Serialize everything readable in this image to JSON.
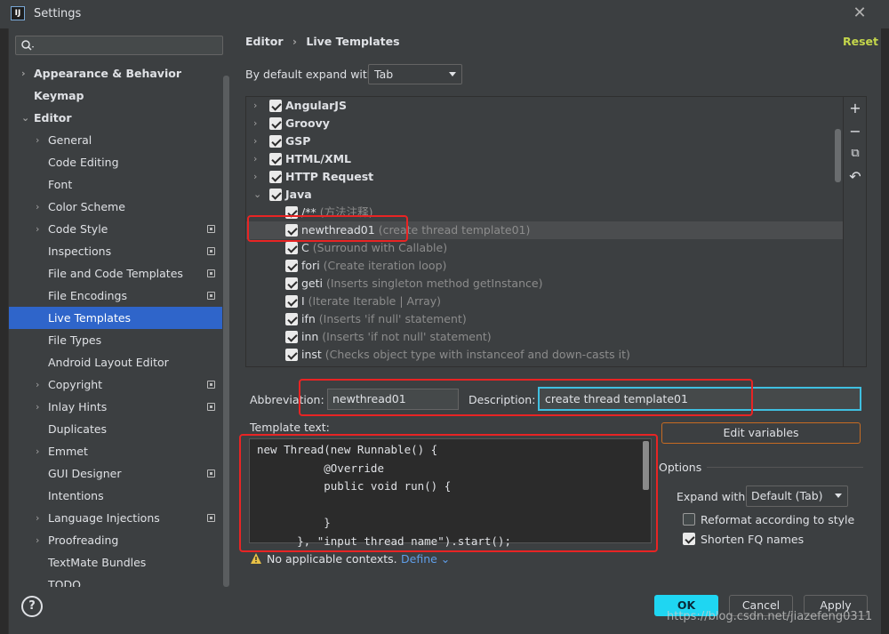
{
  "window": {
    "title": "Settings",
    "logo": "IJ",
    "close": "✕"
  },
  "search": {
    "placeholder": ""
  },
  "tree": [
    {
      "label": "Appearance & Behavior",
      "bold": true,
      "arrow": "›",
      "indent": 0
    },
    {
      "label": "Keymap",
      "bold": true,
      "arrow": "",
      "indent": 0
    },
    {
      "label": "Editor",
      "bold": true,
      "arrow": "⌄",
      "indent": 0
    },
    {
      "label": "General",
      "arrow": "›",
      "indent": 1
    },
    {
      "label": "Code Editing",
      "arrow": "",
      "indent": 1
    },
    {
      "label": "Font",
      "arrow": "",
      "indent": 1
    },
    {
      "label": "Color Scheme",
      "arrow": "›",
      "indent": 1
    },
    {
      "label": "Code Style",
      "arrow": "›",
      "indent": 1,
      "copy": true
    },
    {
      "label": "Inspections",
      "arrow": "",
      "indent": 1,
      "copy": true
    },
    {
      "label": "File and Code Templates",
      "arrow": "",
      "indent": 1,
      "copy": true
    },
    {
      "label": "File Encodings",
      "arrow": "",
      "indent": 1,
      "copy": true
    },
    {
      "label": "Live Templates",
      "arrow": "",
      "indent": 1,
      "selected": true
    },
    {
      "label": "File Types",
      "arrow": "",
      "indent": 1
    },
    {
      "label": "Android Layout Editor",
      "arrow": "",
      "indent": 1
    },
    {
      "label": "Copyright",
      "arrow": "›",
      "indent": 1,
      "copy": true
    },
    {
      "label": "Inlay Hints",
      "arrow": "›",
      "indent": 1,
      "copy": true
    },
    {
      "label": "Duplicates",
      "arrow": "",
      "indent": 1
    },
    {
      "label": "Emmet",
      "arrow": "›",
      "indent": 1
    },
    {
      "label": "GUI Designer",
      "arrow": "",
      "indent": 1,
      "copy": true
    },
    {
      "label": "Intentions",
      "arrow": "",
      "indent": 1
    },
    {
      "label": "Language Injections",
      "arrow": "›",
      "indent": 1,
      "copy": true
    },
    {
      "label": "Proofreading",
      "arrow": "›",
      "indent": 1
    },
    {
      "label": "TextMate Bundles",
      "arrow": "",
      "indent": 1
    },
    {
      "label": "TODO",
      "arrow": "",
      "indent": 1
    }
  ],
  "breadcrumb": {
    "parent": "Editor",
    "sep": "›",
    "current": "Live Templates"
  },
  "reset_label": "Reset",
  "expand": {
    "label": "By default expand with",
    "value": "Tab"
  },
  "templates": [
    {
      "name": "AngularJS",
      "desc": "",
      "group": true,
      "arrow": "›"
    },
    {
      "name": "Groovy",
      "desc": "",
      "group": true,
      "arrow": "›"
    },
    {
      "name": "GSP",
      "desc": "",
      "group": true,
      "arrow": "›"
    },
    {
      "name": "HTML/XML",
      "desc": "",
      "group": true,
      "arrow": "›"
    },
    {
      "name": "HTTP Request",
      "desc": "",
      "group": true,
      "arrow": "›"
    },
    {
      "name": "Java",
      "desc": "",
      "group": true,
      "arrow": "⌄"
    },
    {
      "name": "/**",
      "desc": " (方法注释)",
      "group": false
    },
    {
      "name": "newthread01",
      "desc": " (create thread template01)",
      "group": false,
      "selected": true
    },
    {
      "name": "C",
      "desc": " (Surround with Callable)",
      "group": false
    },
    {
      "name": "fori",
      "desc": " (Create iteration loop)",
      "group": false
    },
    {
      "name": "geti",
      "desc": " (Inserts singleton method getInstance)",
      "group": false
    },
    {
      "name": "I",
      "desc": " (Iterate Iterable | Array)",
      "group": false
    },
    {
      "name": "ifn",
      "desc": " (Inserts 'if null' statement)",
      "group": false
    },
    {
      "name": "inn",
      "desc": " (Inserts 'if not null' statement)",
      "group": false
    },
    {
      "name": "inst",
      "desc": " (Checks object type with instanceof and down-casts it)",
      "group": false
    }
  ],
  "side_toolbar": {
    "add": "+",
    "remove": "−",
    "copy": "⧉",
    "restore": "↶"
  },
  "abbreviation": {
    "label": "Abbreviation:",
    "value": "newthread01"
  },
  "description": {
    "label": "Description:",
    "value": "create thread template01"
  },
  "template_text": {
    "label": "Template text:",
    "code": "new Thread(new Runnable() {\n          @Override\n          public void run() {\n\n          }\n      }, \"input thread name\").start();"
  },
  "edit_variables": "Edit variables",
  "options": {
    "label": "Options",
    "expand_with_label": "Expand with",
    "expand_with_value": "Default (Tab)",
    "reformat": {
      "label": "Reformat according to style",
      "checked": false
    },
    "shorten": {
      "label": "Shorten FQ names",
      "checked": true
    }
  },
  "context": {
    "text": "No applicable contexts.",
    "define": "Define ⌄"
  },
  "buttons": {
    "help": "?",
    "ok": "OK",
    "cancel": "Cancel",
    "apply": "Apply"
  },
  "watermark": "https://blog.csdn.net/jiazefeng0311"
}
